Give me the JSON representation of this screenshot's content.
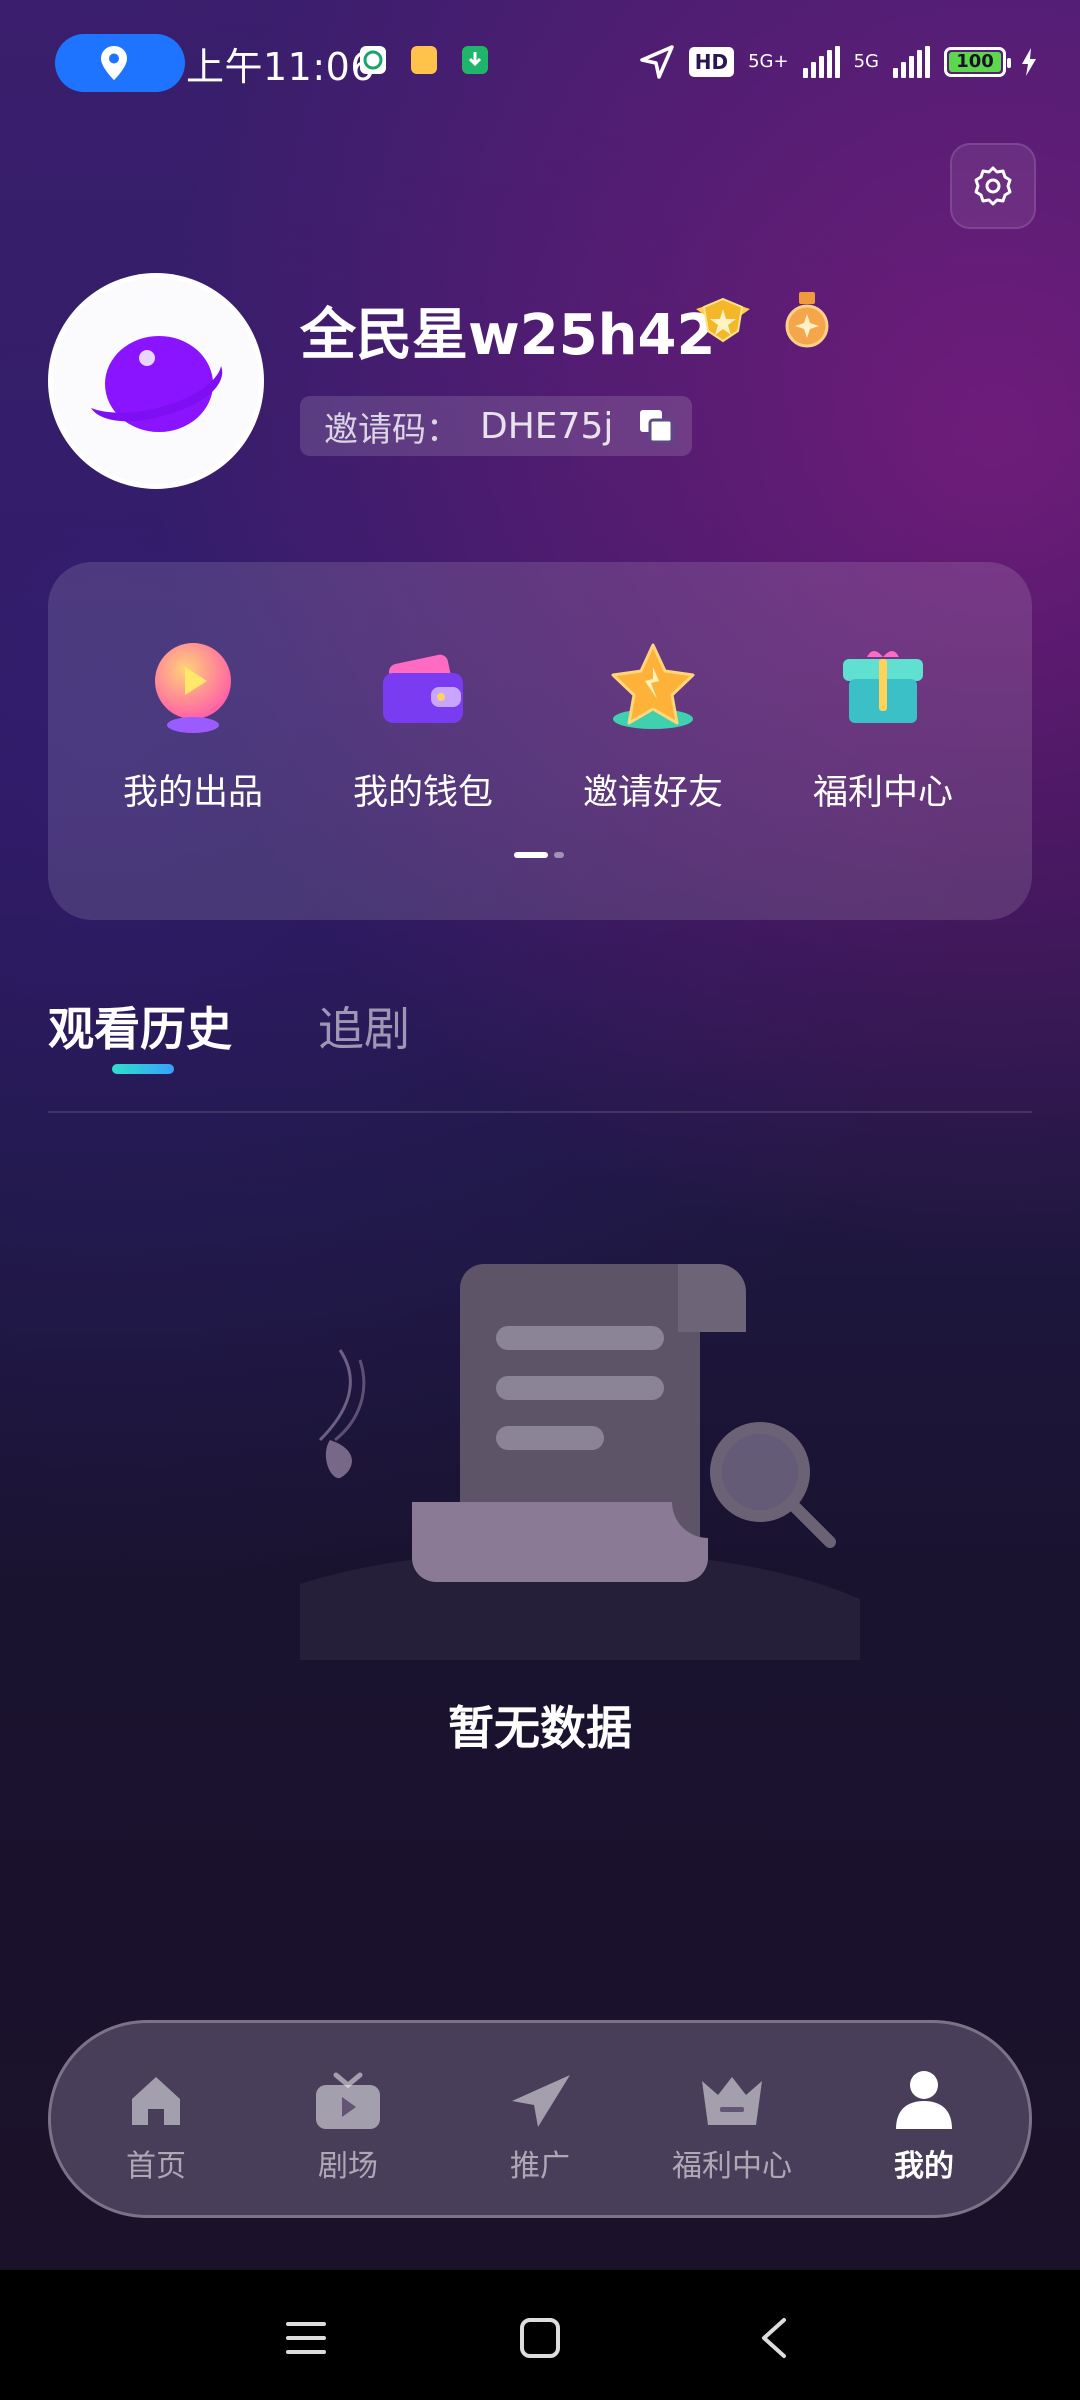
{
  "status_bar": {
    "time": "上午11:06",
    "hd_label": "HD",
    "signal1": "5G+",
    "signal2": "5G",
    "battery": "100"
  },
  "profile": {
    "username": "全民星w25h42",
    "invite_label": "邀请码：",
    "invite_code": "DHE75j"
  },
  "quick_actions": [
    {
      "label": "我的出品",
      "icon": "play-orb-icon"
    },
    {
      "label": "我的钱包",
      "icon": "wallet-icon"
    },
    {
      "label": "邀请好友",
      "icon": "star-icon"
    },
    {
      "label": "福利中心",
      "icon": "gift-box-icon"
    }
  ],
  "tabs": [
    {
      "label": "观看历史",
      "active": true
    },
    {
      "label": "追剧",
      "active": false
    }
  ],
  "empty_state": {
    "message": "暂无数据"
  },
  "bottom_nav": [
    {
      "label": "首页",
      "icon": "home-icon",
      "active": false
    },
    {
      "label": "剧场",
      "icon": "tv-icon",
      "active": false
    },
    {
      "label": "推广",
      "icon": "paper-plane-icon",
      "active": false
    },
    {
      "label": "福利中心",
      "icon": "crown-icon",
      "active": false
    },
    {
      "label": "我的",
      "icon": "person-icon",
      "active": true
    }
  ],
  "colors": {
    "accent_blue": "#1f74ff",
    "tab_indicator": "#2de0c8",
    "battery_green": "#5dd84d"
  }
}
